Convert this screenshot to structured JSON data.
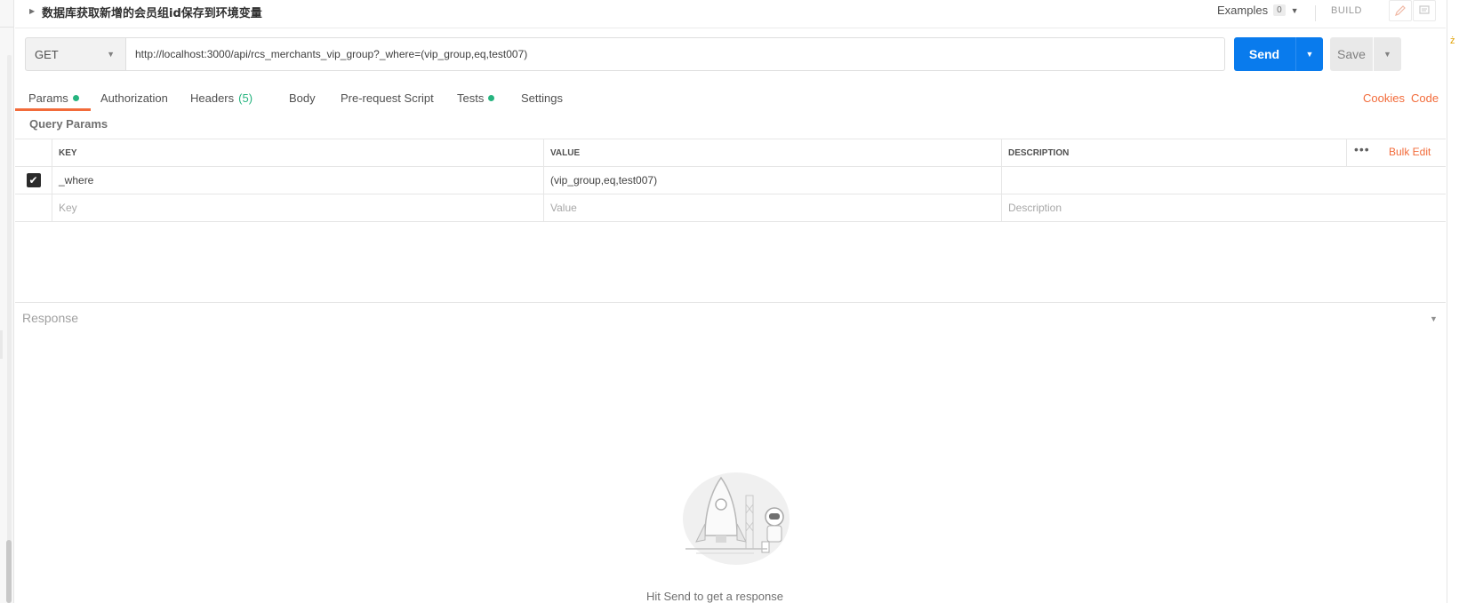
{
  "request": {
    "name": "数据库获取新增的会员组id保存到环境变量",
    "examples_label": "Examples",
    "examples_count": "0",
    "build_label": "BUILD",
    "method": "GET",
    "url": "http://localhost:3000/api/rcs_merchants_vip_group?_where=(vip_group,eq,test007)",
    "send_label": "Send",
    "save_label": "Save"
  },
  "tabs": [
    {
      "label": "Params",
      "has_dot": true
    },
    {
      "label": "Authorization"
    },
    {
      "label": "Headers",
      "count": "(5)"
    },
    {
      "label": "Body"
    },
    {
      "label": "Pre-request Script"
    },
    {
      "label": "Tests",
      "has_dot": true
    },
    {
      "label": "Settings"
    }
  ],
  "tab_links": {
    "cookies": "Cookies",
    "code": "Code"
  },
  "query_params": {
    "title": "Query Params",
    "columns": {
      "key": "KEY",
      "value": "VALUE",
      "description": "DESCRIPTION"
    },
    "bulk_edit": "Bulk Edit",
    "more": "•••",
    "rows": [
      {
        "checked": true,
        "key": "_where",
        "value": "(vip_group,eq,test007)",
        "description": ""
      }
    ],
    "placeholders": {
      "key": "Key",
      "value": "Value",
      "description": "Description"
    }
  },
  "response": {
    "label": "Response",
    "empty_hint": "Hit Send to get a response"
  },
  "colors": {
    "accent": "#f26b3a",
    "send_blue": "#097bed",
    "status_green": "#26b47f"
  },
  "icons": {
    "header_caret": "caret-right-icon",
    "edit": "pencil-icon",
    "comment": "comment-icon",
    "check": "check-icon"
  }
}
